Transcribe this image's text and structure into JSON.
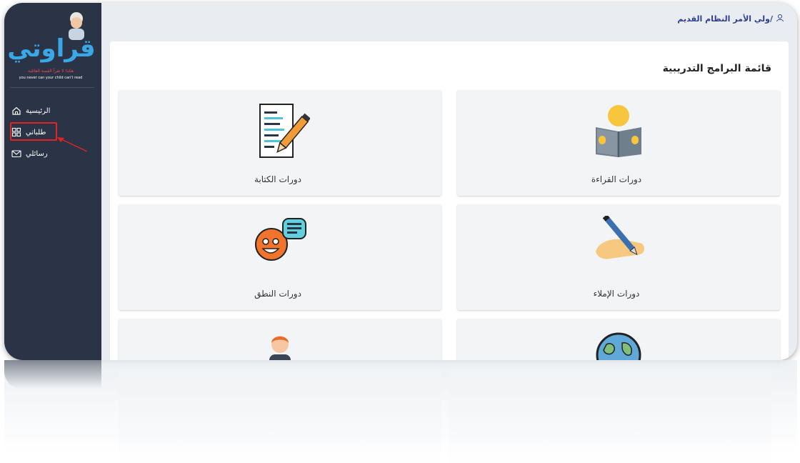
{
  "app": {
    "logo_text": "قراوتي",
    "logo_tagline_ar": "هكذا لا تقرأ القصة العائلية",
    "logo_tagline_en": "you never can your child can't read"
  },
  "sidebar": {
    "items": [
      {
        "label": "الرئيسية",
        "icon": "home-icon"
      },
      {
        "label": "طلباتي",
        "icon": "grid-icon"
      },
      {
        "label": "رسائلي",
        "icon": "mail-icon"
      }
    ],
    "highlighted_index": 1
  },
  "header": {
    "user_icon": "user-icon",
    "role": "ولي الأمر/",
    "current": "النظام القديم"
  },
  "main": {
    "title": "قائمة البرامج التدريبية",
    "cards": [
      {
        "label": "دورات القراءة",
        "icon": "reading-icon"
      },
      {
        "label": "دورات الكتابة",
        "icon": "writing-icon"
      },
      {
        "label": "دورات الإملاء",
        "icon": "dictation-icon"
      },
      {
        "label": "دورات النطق",
        "icon": "pronunciation-icon"
      },
      {
        "label": "",
        "icon": "globe-icon"
      },
      {
        "label": "",
        "icon": "person-icon"
      }
    ]
  },
  "colors": {
    "sidebar_bg": "#2b3447",
    "accent": "#2d3f8e",
    "highlight": "#e02424",
    "logo_blue": "#3aa7e6"
  }
}
